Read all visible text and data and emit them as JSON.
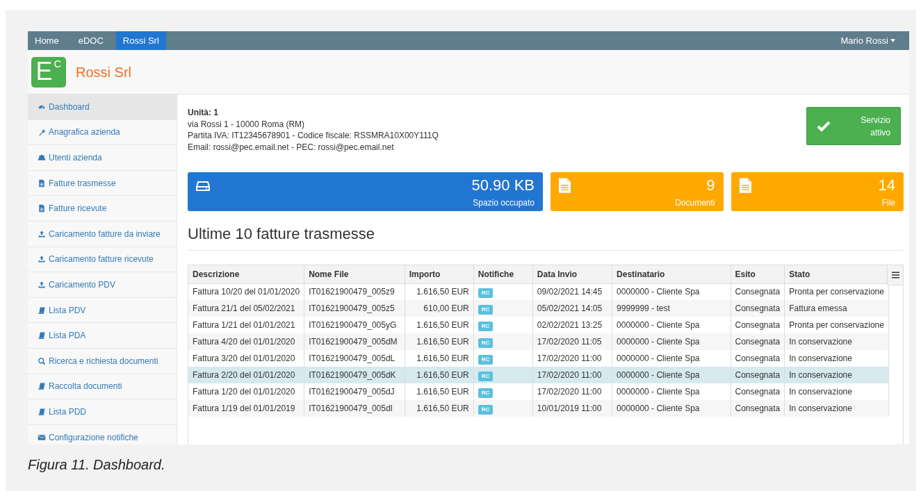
{
  "navbar": {
    "tabs": [
      {
        "label": "Home",
        "selected": false
      },
      {
        "label": "eDOC",
        "selected": false
      },
      {
        "label": "Rossi Srl",
        "selected": true
      }
    ],
    "user": "Mario Rossi"
  },
  "header": {
    "logo": {
      "main": "E",
      "sup": "C"
    },
    "title": "Rossi Srl"
  },
  "sidebar": {
    "items": [
      {
        "label": "Dashboard",
        "kind": "dashboard",
        "selected": true
      },
      {
        "label": "Anagrafica azienda",
        "kind": "wrench",
        "selected": false
      },
      {
        "label": "Utenti azienda",
        "kind": "users",
        "selected": false
      },
      {
        "label": "Fatture trasmesse",
        "kind": "file",
        "selected": false
      },
      {
        "label": "Fatture ricevute",
        "kind": "file",
        "selected": false
      },
      {
        "label": "Caricamento fatture da inviare",
        "kind": "upload",
        "selected": false
      },
      {
        "label": "Caricamento fatture ricevute",
        "kind": "upload",
        "selected": false
      },
      {
        "label": "Caricamento PDV",
        "kind": "upload",
        "selected": false
      },
      {
        "label": "Lista PDV",
        "kind": "book",
        "selected": false
      },
      {
        "label": "Lista PDA",
        "kind": "book",
        "selected": false
      },
      {
        "label": "Ricerca e richiesta documenti",
        "kind": "search",
        "selected": false
      },
      {
        "label": "Raccolta documenti",
        "kind": "book",
        "selected": false
      },
      {
        "label": "Lista PDD",
        "kind": "book",
        "selected": false
      },
      {
        "label": "Configurazione notifiche",
        "kind": "envelope",
        "selected": false
      }
    ]
  },
  "unit": {
    "title": "Unità: 1",
    "lines": [
      "via Rossi 1 - 10000 Roma (RM)",
      "Partita IVA: IT12345678901 - Codice fiscale: RSSMRA10X00Y111Q",
      "Email: rossi@pec.email.net - PEC: rossi@pec.email.net"
    ]
  },
  "service_status": {
    "label": "Servizio attivo"
  },
  "stats": [
    {
      "value": "50.90 KB",
      "label": "Spazio occupato",
      "kind": "drive",
      "color": "#2176d2"
    },
    {
      "value": "9",
      "label": "Documenti",
      "kind": "file",
      "color": "#ffa800"
    },
    {
      "value": "14",
      "label": "File",
      "kind": "file",
      "color": "#ffa800"
    }
  ],
  "section_title": "Ultime 10 fatture trasmesse",
  "table": {
    "columns": [
      "Descrizione",
      "Nome File",
      "Importo",
      "Notifiche",
      "Data Invio",
      "Destinatario",
      "Esito",
      "Stato"
    ],
    "rows": [
      {
        "selected": false,
        "cells": [
          "Fattura 10/20 del 01/01/2020",
          "IT01621900479_005z9",
          "1.616,50 EUR",
          "RC",
          "09/02/2021 14:45",
          "0000000 - Cliente Spa",
          "Consegnata",
          "Pronta per conservazione"
        ]
      },
      {
        "selected": false,
        "cells": [
          "Fattura 21/1 del 05/02/2021",
          "IT01621900479_005z5",
          "610,00 EUR",
          "RC",
          "05/02/2021 14:05",
          "9999999 - test",
          "Consegnata",
          "Fattura emessa"
        ]
      },
      {
        "selected": false,
        "cells": [
          "Fattura 1/21 del 01/01/2021",
          "IT01621900479_005yG",
          "1.616,50 EUR",
          "RC",
          "02/02/2021 13:25",
          "0000000 - Cliente Spa",
          "Consegnata",
          "Pronta per conservazione"
        ]
      },
      {
        "selected": false,
        "cells": [
          "Fattura 4/20 del 01/01/2020",
          "IT01621900479_005dM",
          "1.616,50 EUR",
          "RC",
          "17/02/2020 11:05",
          "0000000 - Cliente Spa",
          "Consegnata",
          "In conservazione"
        ]
      },
      {
        "selected": false,
        "cells": [
          "Fattura 3/20 del 01/01/2020",
          "IT01621900479_005dL",
          "1.616,50 EUR",
          "RC",
          "17/02/2020 11:00",
          "0000000 - Cliente Spa",
          "Consegnata",
          "In conservazione"
        ]
      },
      {
        "selected": true,
        "cells": [
          "Fattura 2/20 del 01/01/2020",
          "IT01621900479_005dK",
          "1.616,50 EUR",
          "RC",
          "17/02/2020 11:00",
          "0000000 - Cliente Spa",
          "Consegnata",
          "In conservazione"
        ]
      },
      {
        "selected": false,
        "cells": [
          "Fattura 1/20 del 01/01/2020",
          "IT01621900479_005dJ",
          "1.616,50 EUR",
          "RC",
          "17/02/2020 11:00",
          "0000000 - Cliente Spa",
          "Consegnata",
          "In conservazione"
        ]
      },
      {
        "selected": false,
        "cells": [
          "Fattura 1/19 del 01/01/2019",
          "IT01621900479_005dI",
          "1.616,50 EUR",
          "RC",
          "10/01/2019 11:00",
          "0000000 - Cliente Spa",
          "Consegnata",
          "In conservazione"
        ]
      }
    ]
  },
  "caption": "Figura 11. Dashboard."
}
